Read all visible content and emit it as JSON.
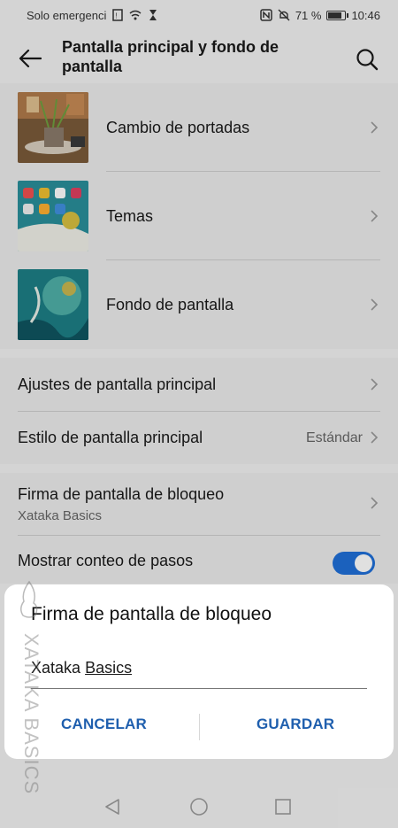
{
  "status_bar": {
    "carrier": "Solo emergenci",
    "battery": "71 %",
    "battery_level": 0.71,
    "time": "10:46"
  },
  "header": {
    "title": "Pantalla principal y fondo de pantalla"
  },
  "section_wallpaper": {
    "items": [
      {
        "label": "Cambio de portadas",
        "icon": "chevron-right-icon"
      },
      {
        "label": "Temas",
        "icon": "chevron-right-icon"
      },
      {
        "label": "Fondo de pantalla",
        "icon": "chevron-right-icon"
      }
    ]
  },
  "section_home": {
    "items": [
      {
        "label": "Ajustes de pantalla principal"
      },
      {
        "label": "Estilo de pantalla principal",
        "value": "Estándar"
      }
    ]
  },
  "section_lock": {
    "signature_label": "Firma de pantalla de bloqueo",
    "signature_value": "Xataka Basics",
    "steps_label": "Mostrar conteo de pasos",
    "steps_enabled": true
  },
  "dialog": {
    "title": "Firma de pantalla de bloqueo",
    "input_word1": "Xataka",
    "input_word2": "Basics",
    "cancel_label": "CANCELAR",
    "save_label": "GUARDAR"
  },
  "watermark": {
    "text": "XATAKA BASICS"
  },
  "colors": {
    "accent": "#1f6fd8",
    "dialog_button": "#1f5fae"
  }
}
